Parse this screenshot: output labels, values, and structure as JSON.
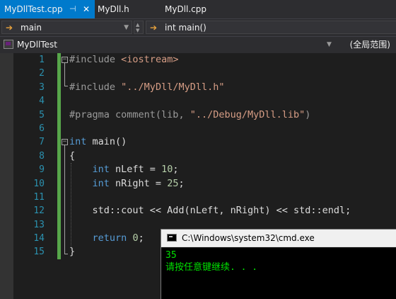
{
  "tabs": [
    {
      "label": "MyDllTest.cpp",
      "active": true
    },
    {
      "label": "MyDll.h",
      "active": false
    },
    {
      "label": "MyDll.cpp",
      "active": false
    }
  ],
  "tab_icons": {
    "pin": "pin-icon",
    "close": "close-icon"
  },
  "nav": {
    "scope_combo": "main",
    "member_combo": "int main()"
  },
  "project_bar": {
    "project": "MyDllTest",
    "scope": "(全局范围)"
  },
  "line_numbers": [
    "1",
    "2",
    "3",
    "4",
    "5",
    "6",
    "7",
    "8",
    "9",
    "10",
    "11",
    "12",
    "13",
    "14",
    "15"
  ],
  "code": {
    "l1_pp": "#include",
    "l1_arg": "<iostream>",
    "l3_pp": "#include",
    "l3_arg": "\"../MyDll/MyDll.h\"",
    "l5_pp": "#pragma",
    "l5_rest_a": " comment(lib, ",
    "l5_str": "\"../Debug/MyDll.lib\"",
    "l5_rest_b": ")",
    "l7_kw": "int",
    "l7_rest": " main()",
    "l8": "{",
    "l9_kw": "int",
    "l9_rest": " nLeft = ",
    "l9_num": "10",
    "l9_end": ";",
    "l10_kw": "int",
    "l10_rest": " nRight = ",
    "l10_num": "25",
    "l10_end": ";",
    "l12": "std::cout << Add(nLeft, nRight) << std::endl;",
    "l14_kw": "return",
    "l14_rest": " ",
    "l14_num": "0",
    "l14_end": ";",
    "l15": "}"
  },
  "console": {
    "title": "C:\\Windows\\system32\\cmd.exe",
    "output_line1": "35",
    "output_line2": "请按任意键继续. . ."
  },
  "colors": {
    "accent": "#007acc",
    "keyword": "#569cd6",
    "string": "#d69d85",
    "number": "#b5cea8",
    "line_number": "#2b91af",
    "console_text": "#00e000"
  }
}
